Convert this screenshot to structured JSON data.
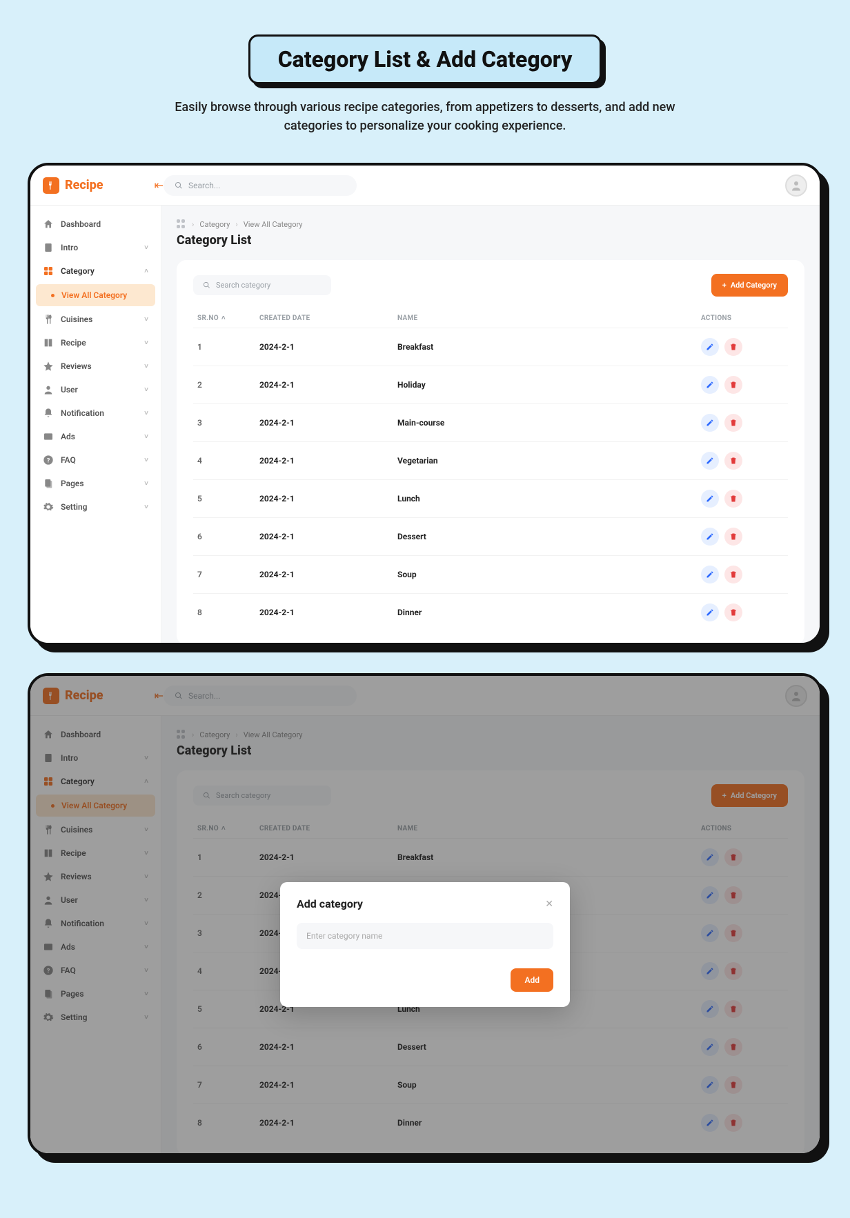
{
  "hero": {
    "title": "Category List & Add Category",
    "subtitle": "Easily browse through various recipe categories, from appetizers to desserts, and add new categories to personalize your cooking experience."
  },
  "app": {
    "logo_text": "Recipe",
    "search_placeholder": "Search...",
    "breadcrumb": {
      "l1": "Category",
      "l2": "View All Category"
    },
    "page_title": "Category List",
    "category_search_placeholder": "Search category",
    "add_button": "Add Category",
    "columns": {
      "srno": "SR.NO",
      "created": "CREATED DATE",
      "name": "NAME",
      "actions": "ACTIONS"
    },
    "sidebar": [
      {
        "label": "Dashboard",
        "icon": "home"
      },
      {
        "label": "Intro",
        "icon": "doc",
        "chev": "down"
      },
      {
        "label": "Category",
        "icon": "grid",
        "chev": "up",
        "active": true
      },
      {
        "label": "View All Category",
        "sub": true,
        "active_sub": true
      },
      {
        "label": "Cuisines",
        "icon": "fork",
        "chev": "down"
      },
      {
        "label": "Recipe",
        "icon": "book",
        "chev": "down"
      },
      {
        "label": "Reviews",
        "icon": "star",
        "chev": "down"
      },
      {
        "label": "User",
        "icon": "user",
        "chev": "down"
      },
      {
        "label": "Notification",
        "icon": "bell",
        "chev": "down"
      },
      {
        "label": "Ads",
        "icon": "ad",
        "chev": "down"
      },
      {
        "label": "FAQ",
        "icon": "faq",
        "chev": "down"
      },
      {
        "label": "Pages",
        "icon": "pages",
        "chev": "down"
      },
      {
        "label": "Setting",
        "icon": "gear",
        "chev": "down"
      }
    ],
    "rows": [
      {
        "sr": "1",
        "date": "2024-2-1",
        "name": "Breakfast"
      },
      {
        "sr": "2",
        "date": "2024-2-1",
        "name": "Holiday"
      },
      {
        "sr": "3",
        "date": "2024-2-1",
        "name": "Main-course"
      },
      {
        "sr": "4",
        "date": "2024-2-1",
        "name": "Vegetarian"
      },
      {
        "sr": "5",
        "date": "2024-2-1",
        "name": "Lunch"
      },
      {
        "sr": "6",
        "date": "2024-2-1",
        "name": "Dessert"
      },
      {
        "sr": "7",
        "date": "2024-2-1",
        "name": "Soup"
      },
      {
        "sr": "8",
        "date": "2024-2-1",
        "name": "Dinner"
      }
    ]
  },
  "modal": {
    "title": "Add category",
    "placeholder": "Enter category name",
    "submit": "Add"
  }
}
